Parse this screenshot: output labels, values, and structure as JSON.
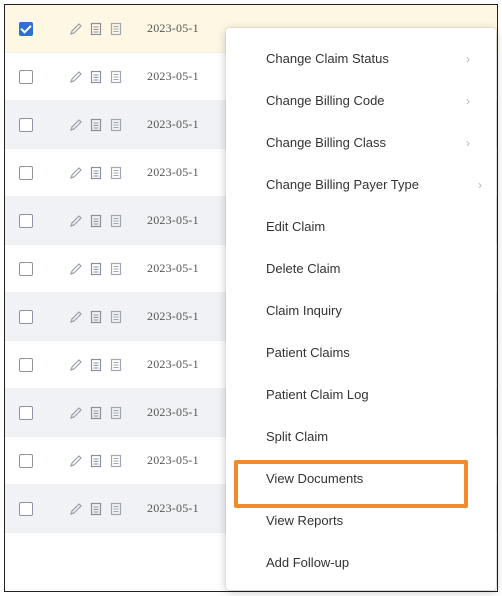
{
  "rows": [
    {
      "date": "2023-05-1",
      "checked": true
    },
    {
      "date": "2023-05-1",
      "checked": false
    },
    {
      "date": "2023-05-1",
      "checked": false
    },
    {
      "date": "2023-05-1",
      "checked": false
    },
    {
      "date": "2023-05-1",
      "checked": false
    },
    {
      "date": "2023-05-1",
      "checked": false
    },
    {
      "date": "2023-05-1",
      "checked": false
    },
    {
      "date": "2023-05-1",
      "checked": false
    },
    {
      "date": "2023-05-1",
      "checked": false
    },
    {
      "date": "2023-05-1",
      "checked": false
    },
    {
      "date": "2023-05-1",
      "checked": false
    }
  ],
  "context_menu": {
    "items": [
      {
        "label": "Change Claim Status",
        "arrow": "›"
      },
      {
        "label": "Change Billing Code",
        "arrow": "›"
      },
      {
        "label": "Change Billing Class",
        "arrow": "›"
      },
      {
        "label": "Change Billing Payer Type",
        "arrow": "›"
      },
      {
        "label": "Edit Claim"
      },
      {
        "label": "Delete Claim"
      },
      {
        "label": "Claim Inquiry"
      },
      {
        "label": "Patient Claims"
      },
      {
        "label": "Patient Claim Log"
      },
      {
        "label": "Split Claim"
      },
      {
        "label": "View Documents"
      },
      {
        "label": "View Reports"
      },
      {
        "label": "Add Follow-up"
      }
    ],
    "highlighted_item": "View Documents",
    "highlight_color": "#f28b2e"
  },
  "colors": {
    "checkbox_checked": "#2f6fd1",
    "row_selected": "#fdf7e3",
    "row_alt": "#f0f2f6"
  }
}
